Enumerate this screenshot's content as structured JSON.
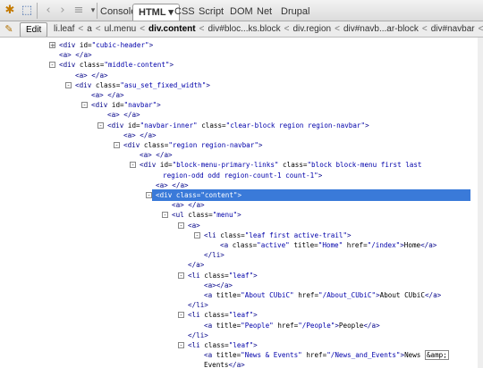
{
  "toolbar": {
    "tabs": [
      {
        "label": "Console"
      },
      {
        "label": "HTML ▾"
      },
      {
        "label": "CSS"
      },
      {
        "label": "Script"
      },
      {
        "label": "DOM"
      },
      {
        "label": "Net"
      },
      {
        "label": "Drupal"
      }
    ]
  },
  "breadcrumb": {
    "edit_label": "Edit",
    "items": [
      "li.leaf",
      "a",
      "ul.menu",
      "div.content",
      "div#bloc...ks.block",
      "div.region",
      "div#navb...ar-block",
      "div#navbar",
      "div.asu...ed_wid"
    ]
  },
  "tree": [
    {
      "html": "<span class='tag'>&lt;div</span> <span class='an'>id=</span><span class='av'>\"cubic-header\"</span><span class='tag'>&gt;</span>",
      "twisty": "+"
    },
    {
      "html": "<span class='tag'>&lt;a&gt;</span> <span class='tag'>&lt;/a&gt;</span>",
      "twisty": ""
    },
    {
      "html": "<span class='tag'>&lt;div</span> <span class='an'>class=</span><span class='av'>\"middle-content\"</span><span class='tag'>&gt;</span>",
      "twisty": "-"
    },
    {
      "html": "<span class='tag'>&lt;a&gt;</span> <span class='tag'>&lt;/a&gt;</span>",
      "twisty": ""
    },
    {
      "html": "<span class='tag'>&lt;div</span> <span class='an'>class=</span><span class='av'>\"asu_set_fixed_width\"</span><span class='tag'>&gt;</span>",
      "twisty": "-"
    },
    {
      "html": "<span class='tag'>&lt;a&gt;</span> <span class='tag'>&lt;/a&gt;</span>",
      "twisty": ""
    },
    {
      "html": "<span class='tag'>&lt;div</span> <span class='an'>id=</span><span class='av'>\"navbar\"</span><span class='tag'>&gt;</span>",
      "twisty": "-"
    },
    {
      "html": "<span class='tag'>&lt;a&gt;</span> <span class='tag'>&lt;/a&gt;</span>",
      "twisty": ""
    },
    {
      "html": "<span class='tag'>&lt;div</span> <span class='an'>id=</span><span class='av'>\"navbar-inner\"</span> <span class='an'>class=</span><span class='av'>\"clear-block region region-navbar\"</span><span class='tag'>&gt;</span>",
      "twisty": "-"
    },
    {
      "html": "<span class='tag'>&lt;a&gt;</span> <span class='tag'>&lt;/a&gt;</span>",
      "twisty": ""
    },
    {
      "html": "<span class='tag'>&lt;div</span> <span class='an'>class=</span><span class='av'>\"region region-navbar\"</span><span class='tag'>&gt;</span>",
      "twisty": "-"
    },
    {
      "html": "<span class='tag'>&lt;a&gt;</span> <span class='tag'>&lt;/a&gt;</span>",
      "twisty": ""
    },
    {
      "html": "<span class='tag'>&lt;div</span> <span class='an'>id=</span><span class='av'>\"block-menu-primary-links\"</span> <span class='an'>class=</span><span class='av'>\"block block-menu first last</span>",
      "twisty": "-"
    },
    {
      "html": "<span class='av'>region-odd odd region-count-1 count-1\"</span><span class='tag'>&gt;</span>",
      "twisty": ""
    },
    {
      "html": "<span class='tag'>&lt;a&gt;</span> <span class='tag'>&lt;/a&gt;</span>",
      "twisty": ""
    },
    {
      "html": "<span class='tag'>&lt;div</span> <span class='an'>class=</span><span class='av'>\"content\"</span><span class='tag'>&gt;</span>",
      "twisty": "-",
      "selected": true
    },
    {
      "html": "<span class='tag'>&lt;a&gt;</span> <span class='tag'>&lt;/a&gt;</span>",
      "twisty": ""
    },
    {
      "html": "<span class='tag'>&lt;ul</span> <span class='an'>class=</span><span class='av'>\"menu\"</span><span class='tag'>&gt;</span>",
      "twisty": "-"
    },
    {
      "html": "<span class='tag'>&lt;a&gt;</span>",
      "twisty": "-"
    },
    {
      "html": "<span class='tag'>&lt;li</span> <span class='an'>class=</span><span class='av'>\"leaf first active-trail\"</span><span class='tag'>&gt;</span>",
      "twisty": "-"
    },
    {
      "html": "<span class='tag'>&lt;a</span> <span class='an'>class=</span><span class='av'>\"active\"</span> <span class='an'>title=</span><span class='av'>\"Home\"</span> <span class='an'>href=</span><span class='av'>\"/index\"</span><span class='tag'>&gt;</span><span class='tx'>Home</span><span class='tag'>&lt;/a&gt;</span>",
      "twisty": ""
    },
    {
      "html": "<span class='tag'>&lt;/li&gt;</span>",
      "twisty": ""
    },
    {
      "html": "<span class='tag'>&lt;/a&gt;</span>",
      "twisty": ""
    },
    {
      "html": "<span class='tag'>&lt;li</span> <span class='an'>class=</span><span class='av'>\"leaf\"</span><span class='tag'>&gt;</span>",
      "twisty": "-"
    },
    {
      "html": "<span class='tag'>&lt;a&gt;&lt;/a&gt;</span>",
      "twisty": ""
    },
    {
      "html": "<span class='tag'>&lt;a</span> <span class='an'>title=</span><span class='av'>\"About CUbiC\"</span> <span class='an'>href=</span><span class='av'>\"/About_CUbiC\"</span><span class='tag'>&gt;</span><span class='tx'>About CUbiC</span><span class='tag'>&lt;/a&gt;</span>",
      "twisty": ""
    },
    {
      "html": "<span class='tag'>&lt;/li&gt;</span>",
      "twisty": ""
    },
    {
      "html": "<span class='tag'>&lt;li</span> <span class='an'>class=</span><span class='av'>\"leaf\"</span><span class='tag'>&gt;</span>",
      "twisty": "-"
    },
    {
      "html": "<span class='tag'>&lt;a</span> <span class='an'>title=</span><span class='av'>\"People\"</span> <span class='an'>href=</span><span class='av'>\"/People\"</span><span class='tag'>&gt;</span><span class='tx'>People</span><span class='tag'>&lt;/a&gt;</span>",
      "twisty": ""
    },
    {
      "html": "<span class='tag'>&lt;/li&gt;</span>",
      "twisty": ""
    },
    {
      "html": "<span class='tag'>&lt;li</span> <span class='an'>class=</span><span class='av'>\"leaf\"</span><span class='tag'>&gt;</span>",
      "twisty": "-"
    },
    {
      "html": "<span class='tag'>&lt;a</span> <span class='an'>title=</span><span class='av'>\"News &amp; Events\"</span> <span class='an'>href=</span><span class='av'>\"/News_and_Events\"</span><span class='tag'>&gt;</span><span class='tx'>News</span> <span class='tx' style='border:1px solid #888;padding:0 1px;'>&amp;amp;</span>",
      "twisty": ""
    },
    {
      "html": "<span class='tx'>Events</span><span class='tag'>&lt;/a&gt;</span>",
      "twisty": ""
    }
  ]
}
